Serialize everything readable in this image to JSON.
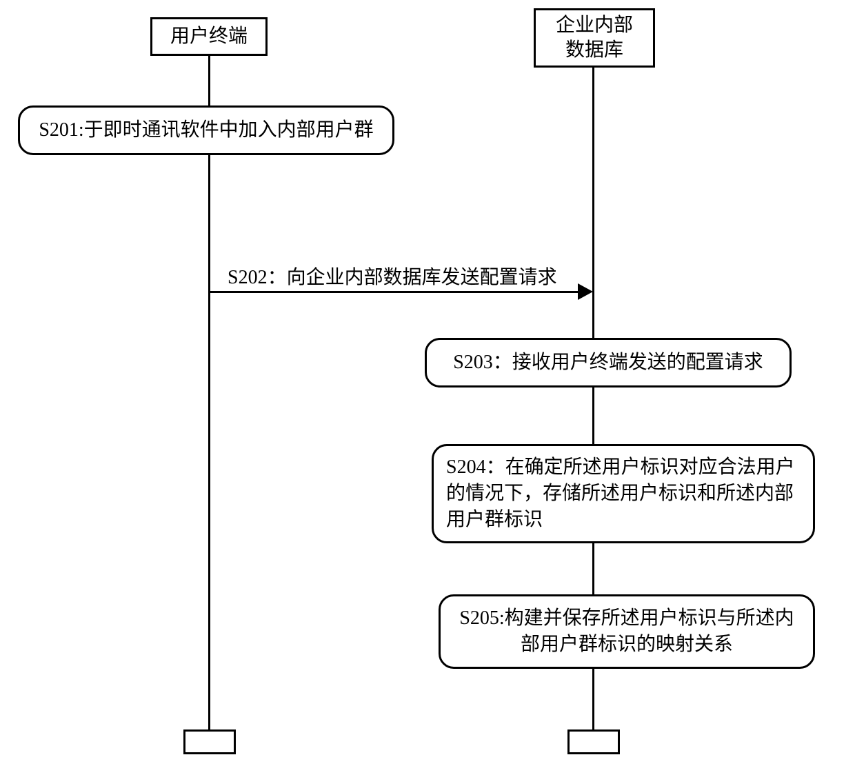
{
  "participants": {
    "left": "用户终端",
    "right": "企业内部\n数据库"
  },
  "steps": {
    "s201": "S201:于即时通讯软件中加入内部用户群",
    "s202": "S202：向企业内部数据库发送配置请求",
    "s203": "S203：接收用户终端发送的配置请求",
    "s204": "S204：在确定所述用户标识对应合法用户的情况下，存储所述用户标识和所述内部用户群标识",
    "s205": "S205:构建并保存所述用户标识与所述内部用户群标识的映射关系"
  }
}
